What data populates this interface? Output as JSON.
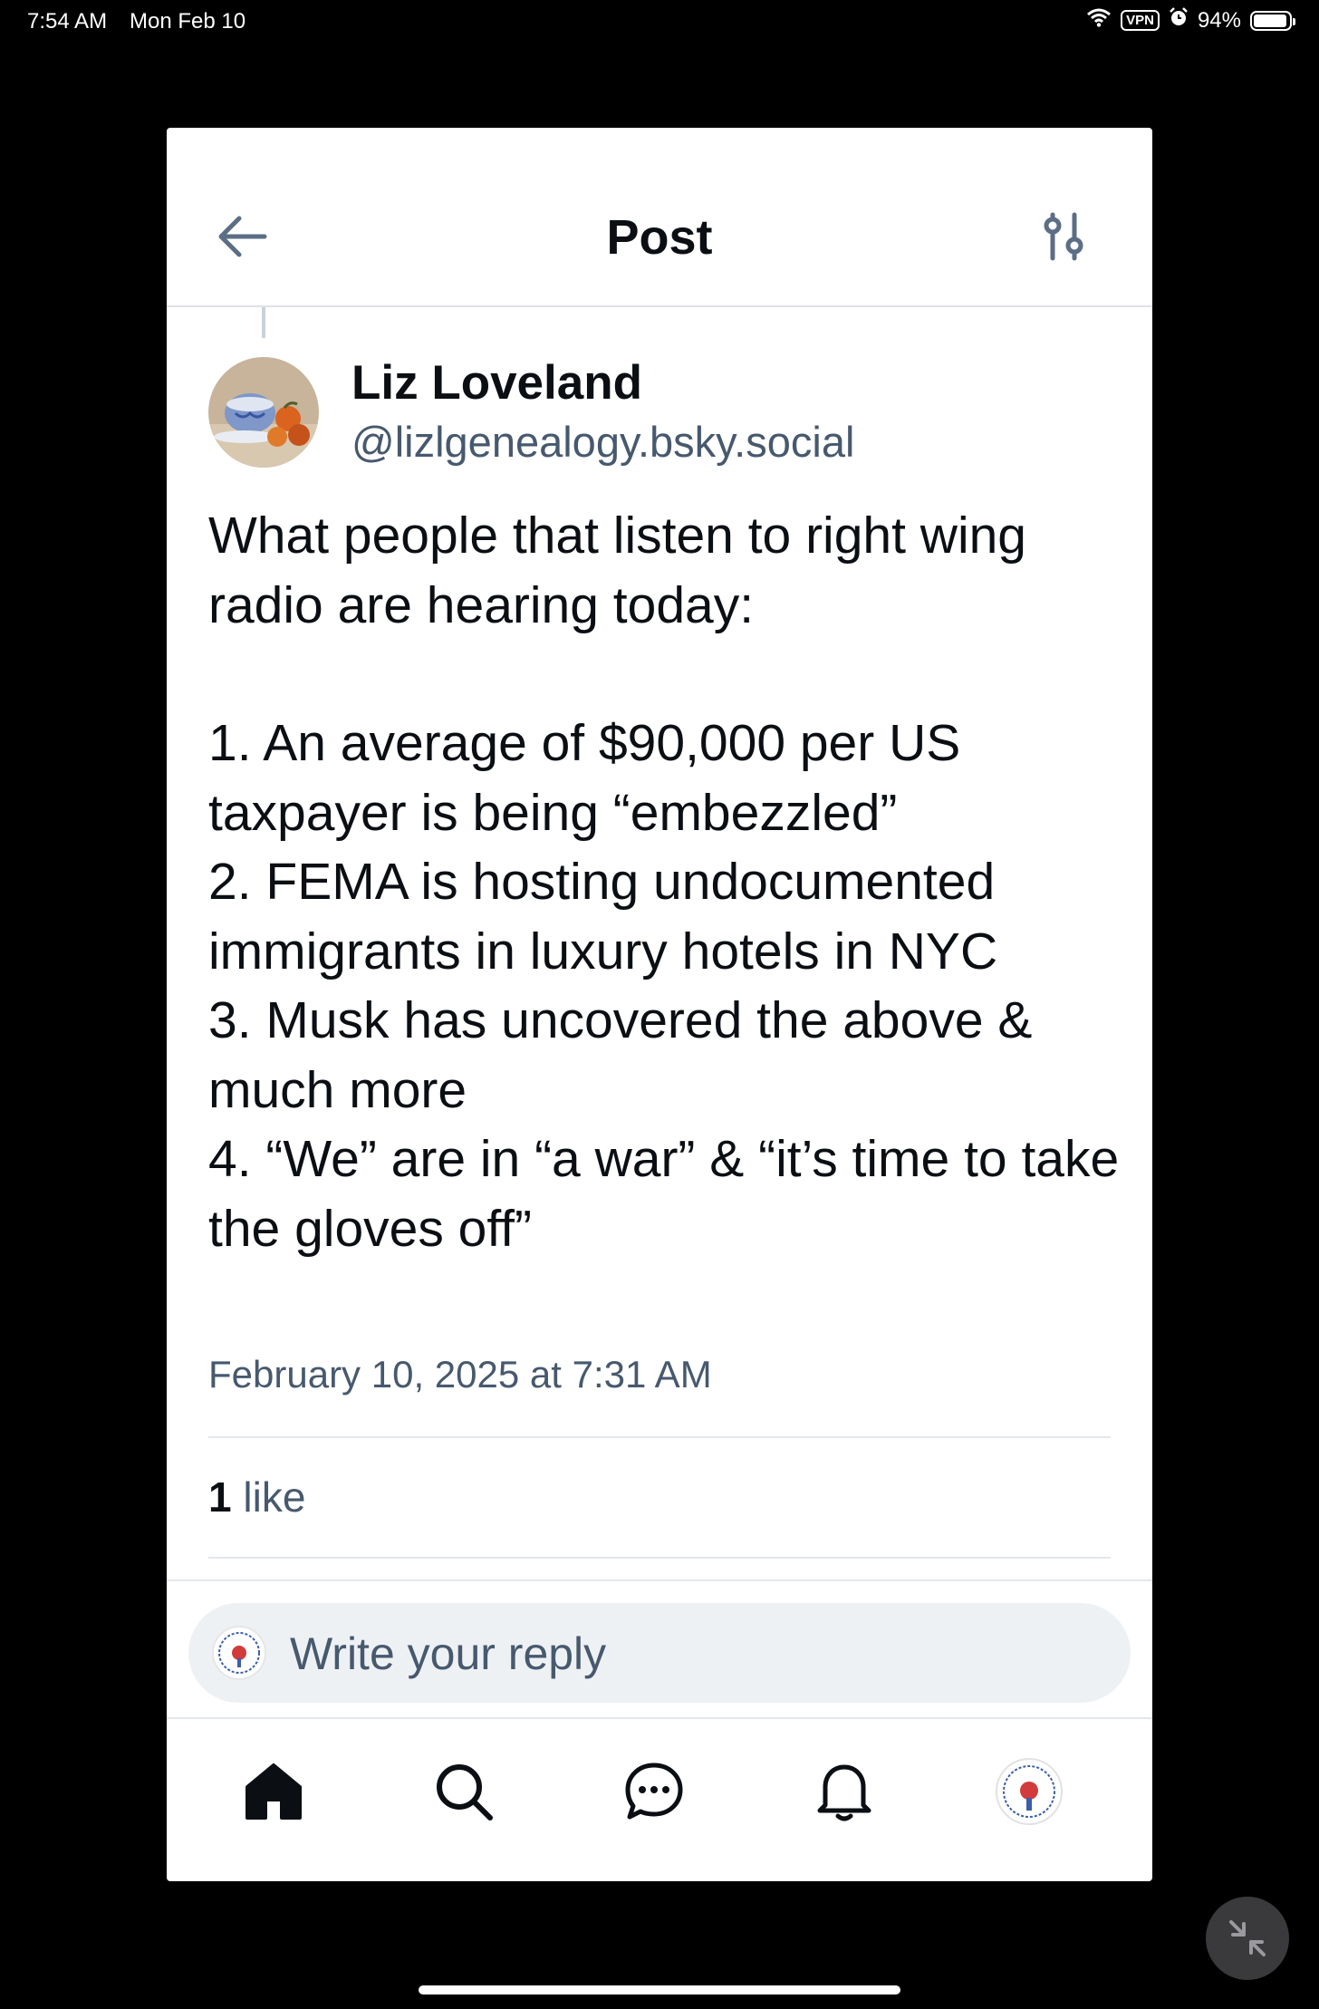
{
  "status_bar": {
    "time": "7:54 AM",
    "date": "Mon Feb 10",
    "vpn": "VPN",
    "battery": "94%"
  },
  "header": {
    "title": "Post",
    "back_icon": "arrow-left-icon",
    "filter_icon": "sliders-icon"
  },
  "post": {
    "author_name": "Liz Loveland",
    "author_handle": "@lizlgenealogy.bsky.social",
    "intro": "What people that listen to right wing radio are hearing today:",
    "items": [
      "1. An average of $90,000 per US taxpayer is being “embezzled”",
      "2. FEMA is hosting undocumented immigrants in luxury hotels in NYC",
      "3. Musk has uncovered the above & much more",
      "4. “We” are in “a war” & “it’s time to take the gloves off”"
    ],
    "timestamp": "February 10, 2025 at 7:31 AM",
    "like_count": "1",
    "like_label": "like"
  },
  "reply": {
    "placeholder": "Write your reply"
  },
  "bottom_nav": {
    "items": [
      "home-icon",
      "search-icon",
      "chat-icon",
      "bell-icon",
      "profile-avatar"
    ]
  },
  "colors": {
    "accent": "#47596e",
    "background": "#000000",
    "surface": "#ffffff"
  }
}
